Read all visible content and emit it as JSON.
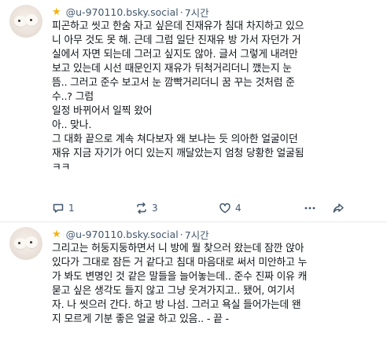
{
  "posts": [
    {
      "handle": "@u-970110.bsky.social",
      "separator": "·",
      "time": "7시간",
      "lines": [
        "피곤하고 씻고 한숨 자고 싶은데 진재유가 침대 차지하고 있으",
        "니 아무 것도 못 해. 근데 그럼 일단 진재유 방 가서 자던가 거",
        "실에서 자면 되는데 그러고 싶지도 않아. 글서 그렇게 내려만",
        "보고 있는데 시선 때문인지 재유가 뒤척거리더니 깼는지 눈",
        "뜸.. 그러고 준수 보고서 눈 깜빡거리더니 꿈 꾸는 것처럼 준",
        "수..? 그럼",
        "일정 바뀌어서 일찍 왔어",
        "아.. 맞나.",
        "그 대화 끝으로 계속 쳐다보자 왜 보냐는 듯 의아한 얼굴이던",
        "재유 지금 자기가 어디 있는지 깨달았는지 엄청 당황한 얼굴됨",
        "ㅋㅋ"
      ],
      "reply_count": "1",
      "repost_count": "3",
      "like_count": "4"
    },
    {
      "handle": "@u-970110.bsky.social",
      "separator": "·",
      "time": "7시간",
      "lines": [
        "그리고는 허둥지둥하면서 니 방에 뭘 찾으러 왔는데 잠깐 앉아",
        "있다가 그대로 잠든 거 같다고 침대 마음대로 써서 미안하고 누",
        "가 봐도 변명인 것 같은 말들을 늘어놓는데.. 준수 진짜 이유 캐",
        "묻고 싶은 생각도 들지 않고 그냥 웃겨가지고.. 됐어, 여기서",
        "자. 나 씻으러 간다. 하고 방 나섬. 그러고 욕실 들어가는데 왠",
        "지 모르게 기분 좋은 얼굴 하고 있음.. - 끝 -"
      ]
    }
  ],
  "colors": {
    "star": "#f5b301",
    "muted": "#42576c",
    "text": "#0f1419",
    "divider": "#e6ebef"
  },
  "icons": {
    "reply": "reply-icon",
    "repost": "repost-icon",
    "like": "heart-icon",
    "more": "more-icon",
    "share": "share-icon"
  }
}
